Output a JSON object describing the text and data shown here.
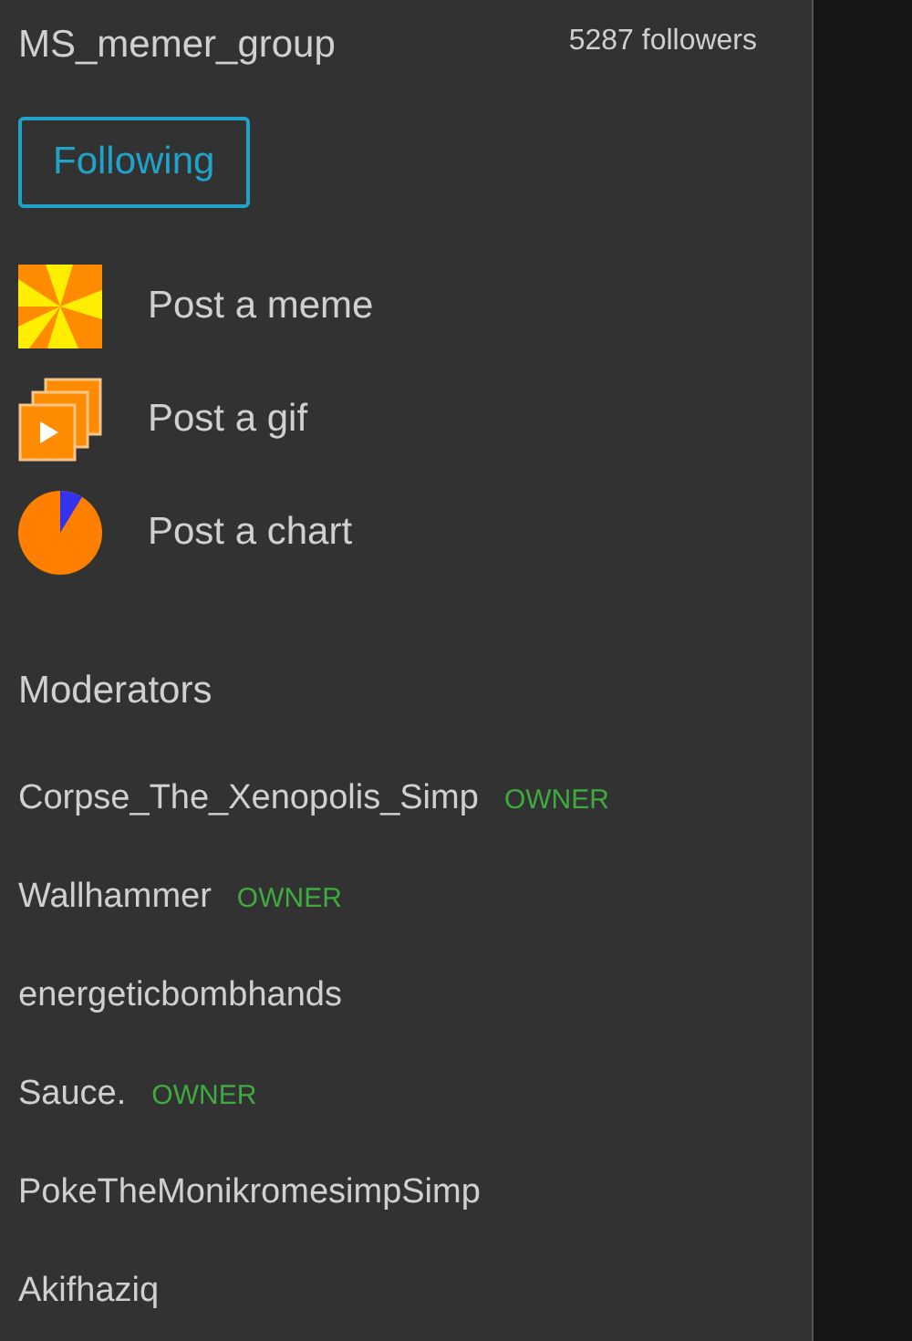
{
  "group": {
    "name": "MS_memer_group",
    "followers": "5287 followers"
  },
  "follow_button": {
    "label": "Following",
    "selected": true
  },
  "post_actions": [
    {
      "kind": "meme",
      "label": "Post a meme"
    },
    {
      "kind": "gif",
      "label": "Post a gif"
    },
    {
      "kind": "chart",
      "label": "Post a chart"
    }
  ],
  "moderators": {
    "title": "Moderators",
    "items": [
      {
        "name": "Corpse_The_Xenopolis_Simp",
        "badge": "OWNER"
      },
      {
        "name": "Wallhammer",
        "badge": "OWNER"
      },
      {
        "name": "energeticbombhands"
      },
      {
        "name": "Sauce.",
        "badge": "OWNER"
      },
      {
        "name": "PokeTheMonikromesimpSimp"
      },
      {
        "name": "Akifhaziq"
      }
    ]
  }
}
